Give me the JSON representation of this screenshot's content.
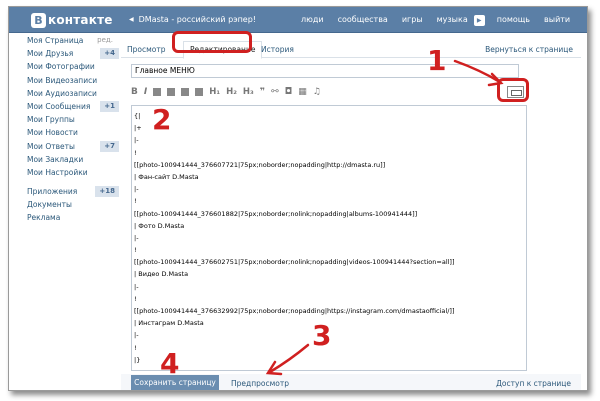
{
  "header": {
    "logo_letter": "В",
    "logo_text": "контакте",
    "back_title": "DMasta - российский рэпер!",
    "nav": [
      "люди",
      "сообщества",
      "игры",
      "музыка",
      "помощь",
      "выйти"
    ]
  },
  "sidebar": {
    "items": [
      {
        "label": "Моя Страница",
        "edit": "ред."
      },
      {
        "label": "Мои Друзья",
        "badge": "+4"
      },
      {
        "label": "Мои Фотографии"
      },
      {
        "label": "Мои Видеозаписи"
      },
      {
        "label": "Мои Аудиозаписи"
      },
      {
        "label": "Мои Сообщения",
        "badge": "+1"
      },
      {
        "label": "Мои Группы"
      },
      {
        "label": "Мои Новости"
      },
      {
        "label": "Мои Ответы",
        "badge": "+7"
      },
      {
        "label": "Мои Закладки"
      },
      {
        "label": "Мои Настройки"
      }
    ],
    "items2": [
      {
        "label": "Приложения",
        "badge": "+18"
      },
      {
        "label": "Документы"
      },
      {
        "label": "Реклама"
      }
    ]
  },
  "tabs": {
    "view": "Просмотр",
    "edit": "Редактирование",
    "history": "История",
    "return": "Вернуться к странице"
  },
  "editor": {
    "title_value": "Главное МЕНЮ",
    "toolbar": {
      "bold": "B",
      "italic": "I",
      "h1": "H₁",
      "h2": "H₂",
      "h3": "H₃"
    },
    "lines": [
      "{|",
      "|+",
      "|-",
      "!",
      "[[photo-100941444_376607721|75px;noborder;nopadding|http://dmasta.ru]]",
      "| Фан-сайт D.Masta",
      "|-",
      "!",
      "[[photo-100941444_376601882|75px;noborder;nolink;nopadding|albums-100941444]]",
      "| Фото D.Masta",
      "|-",
      "!",
      "[[photo-100941444_376602751|75px;noborder;nolink;nopadding|videos-100941444?section=all]]",
      "| Видео D.Masta",
      "|-",
      "!",
      "[[photo-100941444_376632992|75px;noborder;nopadding|https://instagram.com/dmastaofficial/]]",
      "| Инстаграм D.Masta",
      "|-",
      "!",
      "|}"
    ]
  },
  "footer": {
    "save": "Сохранить страницу",
    "preview": "Предпросмотр",
    "access": "Доступ к странице"
  },
  "annotations": {
    "n1": "1",
    "n2": "2",
    "n3": "3",
    "n4": "4",
    "color": "#d02020"
  },
  "colors": {
    "header": "#5b7fa6",
    "link": "#2b587a",
    "button": "#6a8db0"
  }
}
